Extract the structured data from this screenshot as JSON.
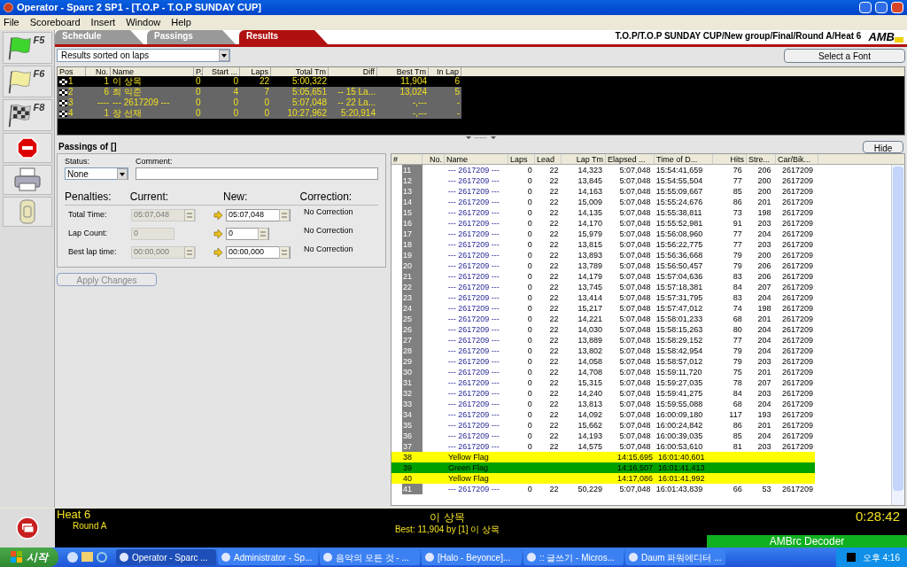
{
  "window": {
    "title": "Operator - Sparc 2 SP1 - [T.O.P - T.O.P SUNDAY CUP]"
  },
  "menu": [
    "File",
    "Scoreboard",
    "Insert",
    "Window",
    "Help"
  ],
  "toolbar": [
    {
      "kind": "green-flag",
      "key": "F5"
    },
    {
      "kind": "yellow-flag",
      "key": "F6"
    },
    {
      "kind": "checkered-flag",
      "key": "F8"
    },
    {
      "kind": "stop"
    },
    {
      "kind": "printer"
    },
    {
      "kind": "transponder"
    }
  ],
  "tabs": [
    {
      "label": "Schedule",
      "selected": false
    },
    {
      "label": "Passings",
      "selected": false
    },
    {
      "label": "Results",
      "selected": true
    }
  ],
  "breadcrumb": "T.O.P/T.O.P SUNDAY CUP/New group/Final/Round A/Heat 6",
  "logo": "AMB",
  "sort_select": {
    "value": "Results sorted on laps"
  },
  "font_button": "Select a Font",
  "results": {
    "columns": [
      "Pos",
      "No.",
      "Name",
      "P.",
      "Start ...",
      "Laps",
      "Total Tm",
      "Diff",
      "Best Tm",
      "In Lap"
    ],
    "rows": [
      {
        "selected": false,
        "cells": [
          "1",
          "1",
          "이 상목",
          "0",
          "0",
          "22",
          "5:00,322",
          null,
          "11,904",
          "6"
        ]
      },
      {
        "selected": true,
        "cells": [
          "2",
          "6",
          "최 익준",
          "0",
          "4",
          "7",
          "5:05,651",
          "-- 15 La...",
          "13,024",
          "5"
        ]
      },
      {
        "selected": true,
        "cells": [
          "3",
          "----",
          "--- 2617209 ---",
          "0",
          "0",
          "0",
          "5:07,048",
          "-- 22 La...",
          "-,---",
          "-"
        ]
      },
      {
        "selected": true,
        "cells": [
          "4",
          "1",
          "장 선재",
          "0",
          "0",
          "0",
          "10:27,962",
          "5:20,914",
          "-,---",
          "-"
        ]
      }
    ]
  },
  "passings_title": "Passings of []",
  "hide_button": "Hide",
  "form": {
    "status_label": "Status:",
    "status_value": "None",
    "comment_label": "Comment:",
    "headers": [
      "Penalties:",
      "Current:",
      "New:",
      "Correction:"
    ],
    "rows": [
      {
        "kind": "time",
        "label": "Total Time:",
        "current": "05:07,048",
        "new": "05:07,048",
        "correction": "No Correction"
      },
      {
        "kind": "count",
        "label": "Lap Count:",
        "current": "0",
        "new": "0",
        "correction": "No Correction"
      },
      {
        "kind": "time",
        "label": "Best lap time:",
        "current": "00:00,000",
        "new": "00:00,000",
        "correction": "No Correction"
      }
    ],
    "apply_button": {
      "label": "Apply Changes",
      "disabled": true
    }
  },
  "passings": {
    "columns": [
      "#",
      "No.",
      "Name",
      "Laps",
      "Lead",
      "Lap Tm",
      "Elapsed ...",
      "Time of D...",
      "Hits",
      "Stre...",
      "Car/Bik..."
    ],
    "rows": [
      {
        "kind": "lap",
        "num": "11",
        "name": "--- 2617209 ---",
        "cells": [
          "0",
          "22",
          "14,323",
          "5:07,048",
          "15:54:41,659",
          "76",
          "206",
          "2617209"
        ]
      },
      {
        "kind": "lap",
        "num": "12",
        "name": "--- 2617209 ---",
        "cells": [
          "0",
          "22",
          "13,845",
          "5:07,048",
          "15:54:55,504",
          "77",
          "200",
          "2617209"
        ]
      },
      {
        "kind": "lap",
        "num": "13",
        "name": "--- 2617209 ---",
        "cells": [
          "0",
          "22",
          "14,163",
          "5:07,048",
          "15:55:09,667",
          "85",
          "200",
          "2617209"
        ]
      },
      {
        "kind": "lap",
        "num": "14",
        "name": "--- 2617209 ---",
        "cells": [
          "0",
          "22",
          "15,009",
          "5:07,048",
          "15:55:24,676",
          "86",
          "201",
          "2617209"
        ]
      },
      {
        "kind": "lap",
        "num": "15",
        "name": "--- 2617209 ---",
        "cells": [
          "0",
          "22",
          "14,135",
          "5:07,048",
          "15:55:38,811",
          "73",
          "198",
          "2617209"
        ]
      },
      {
        "kind": "lap",
        "num": "16",
        "name": "--- 2617209 ---",
        "cells": [
          "0",
          "22",
          "14,170",
          "5:07,048",
          "15:55:52,981",
          "91",
          "203",
          "2617209"
        ]
      },
      {
        "kind": "lap",
        "num": "17",
        "name": "--- 2617209 ---",
        "cells": [
          "0",
          "22",
          "15,979",
          "5:07,048",
          "15:56:08,960",
          "77",
          "204",
          "2617209"
        ]
      },
      {
        "kind": "lap",
        "num": "18",
        "name": "--- 2617209 ---",
        "cells": [
          "0",
          "22",
          "13,815",
          "5:07,048",
          "15:56:22,775",
          "77",
          "203",
          "2617209"
        ]
      },
      {
        "kind": "lap",
        "num": "19",
        "name": "--- 2617209 ---",
        "cells": [
          "0",
          "22",
          "13,893",
          "5:07,048",
          "15:56:36,668",
          "79",
          "200",
          "2617209"
        ]
      },
      {
        "kind": "lap",
        "num": "20",
        "name": "--- 2617209 ---",
        "cells": [
          "0",
          "22",
          "13,789",
          "5:07,048",
          "15:56:50,457",
          "79",
          "206",
          "2617209"
        ]
      },
      {
        "kind": "lap",
        "num": "21",
        "name": "--- 2617209 ---",
        "cells": [
          "0",
          "22",
          "14,179",
          "5:07,048",
          "15:57:04,636",
          "83",
          "206",
          "2617209"
        ]
      },
      {
        "kind": "lap",
        "num": "22",
        "name": "--- 2617209 ---",
        "cells": [
          "0",
          "22",
          "13,745",
          "5:07,048",
          "15:57:18,381",
          "84",
          "207",
          "2617209"
        ]
      },
      {
        "kind": "lap",
        "num": "23",
        "name": "--- 2617209 ---",
        "cells": [
          "0",
          "22",
          "13,414",
          "5:07,048",
          "15:57:31,795",
          "83",
          "204",
          "2617209"
        ]
      },
      {
        "kind": "lap",
        "num": "24",
        "name": "--- 2617209 ---",
        "cells": [
          "0",
          "22",
          "15,217",
          "5:07,048",
          "15:57:47,012",
          "74",
          "198",
          "2617209"
        ]
      },
      {
        "kind": "lap",
        "num": "25",
        "name": "--- 2617209 ---",
        "cells": [
          "0",
          "22",
          "14,221",
          "5:07,048",
          "15:58:01,233",
          "68",
          "201",
          "2617209"
        ]
      },
      {
        "kind": "lap",
        "num": "26",
        "name": "--- 2617209 ---",
        "cells": [
          "0",
          "22",
          "14,030",
          "5:07,048",
          "15:58:15,263",
          "80",
          "204",
          "2617209"
        ]
      },
      {
        "kind": "lap",
        "num": "27",
        "name": "--- 2617209 ---",
        "cells": [
          "0",
          "22",
          "13,889",
          "5:07,048",
          "15:58:29,152",
          "77",
          "204",
          "2617209"
        ]
      },
      {
        "kind": "lap",
        "num": "28",
        "name": "--- 2617209 ---",
        "cells": [
          "0",
          "22",
          "13,802",
          "5:07,048",
          "15:58:42,954",
          "79",
          "204",
          "2617209"
        ]
      },
      {
        "kind": "lap",
        "num": "29",
        "name": "--- 2617209 ---",
        "cells": [
          "0",
          "22",
          "14,058",
          "5:07,048",
          "15:58:57,012",
          "79",
          "203",
          "2617209"
        ]
      },
      {
        "kind": "lap",
        "num": "30",
        "name": "--- 2617209 ---",
        "cells": [
          "0",
          "22",
          "14,708",
          "5:07,048",
          "15:59:11,720",
          "75",
          "201",
          "2617209"
        ]
      },
      {
        "kind": "lap",
        "num": "31",
        "name": "--- 2617209 ---",
        "cells": [
          "0",
          "22",
          "15,315",
          "5:07,048",
          "15:59:27,035",
          "78",
          "207",
          "2617209"
        ]
      },
      {
        "kind": "lap",
        "num": "32",
        "name": "--- 2617209 ---",
        "cells": [
          "0",
          "22",
          "14,240",
          "5:07,048",
          "15:59:41,275",
          "84",
          "203",
          "2617209"
        ]
      },
      {
        "kind": "lap",
        "num": "33",
        "name": "--- 2617209 ---",
        "cells": [
          "0",
          "22",
          "13,813",
          "5:07,048",
          "15:59:55,088",
          "68",
          "204",
          "2617209"
        ]
      },
      {
        "kind": "lap",
        "num": "34",
        "name": "--- 2617209 ---",
        "cells": [
          "0",
          "22",
          "14,092",
          "5:07,048",
          "16:00:09,180",
          "117",
          "193",
          "2617209"
        ]
      },
      {
        "kind": "lap",
        "num": "35",
        "name": "--- 2617209 ---",
        "cells": [
          "0",
          "22",
          "15,662",
          "5:07,048",
          "16:00:24,842",
          "86",
          "201",
          "2617209"
        ]
      },
      {
        "kind": "lap",
        "num": "36",
        "name": "--- 2617209 ---",
        "cells": [
          "0",
          "22",
          "14,193",
          "5:07,048",
          "16:00:39,035",
          "85",
          "204",
          "2617209"
        ]
      },
      {
        "kind": "lap",
        "num": "37",
        "name": "--- 2617209 ---",
        "cells": [
          "0",
          "22",
          "14,575",
          "5:07,048",
          "16:00:53,610",
          "81",
          "203",
          "2617209"
        ]
      },
      {
        "kind": "flag",
        "num": "38",
        "name": "Yellow Flag",
        "color": "#ffff00",
        "elapsed": "14:15,695",
        "time_of_day": "16:01:40,601"
      },
      {
        "kind": "flag",
        "num": "39",
        "name": "Green Flag",
        "color": "#00a000",
        "elapsed": "14:16,507",
        "time_of_day": "16:01:41,413"
      },
      {
        "kind": "flag",
        "num": "40",
        "name": "Yellow Flag",
        "color": "#ffff00",
        "elapsed": "14:17,086",
        "time_of_day": "16:01:41,992"
      },
      {
        "kind": "lap",
        "num": "41",
        "name": "--- 2617209 ---",
        "cells": [
          "0",
          "22",
          "50,229",
          "5:07,048",
          "16:01:43,839",
          "66",
          "53",
          "2617209"
        ]
      }
    ]
  },
  "status": {
    "heat": "Heat 6",
    "round": "Round A",
    "leader": "이 상목",
    "best": "Best: 11,904 by [1] 이 상목",
    "clock": "0:28:42",
    "decoder": "AMBrc Decoder"
  },
  "taskbar": {
    "start": "시작",
    "tasks": [
      {
        "label": "Operator - Sparc ...",
        "selected": true
      },
      {
        "label": "Administrator - Sp...",
        "selected": false
      },
      {
        "label": "음악의 모든 것 - ...",
        "selected": false
      },
      {
        "label": "[Halo - Beyonce]...",
        "selected": false
      },
      {
        "label": ":: 글쓰기 - Micros...",
        "selected": false
      },
      {
        "label": "Daum 파워에디터 ...",
        "selected": false
      }
    ],
    "clock": "오후 4:16"
  }
}
